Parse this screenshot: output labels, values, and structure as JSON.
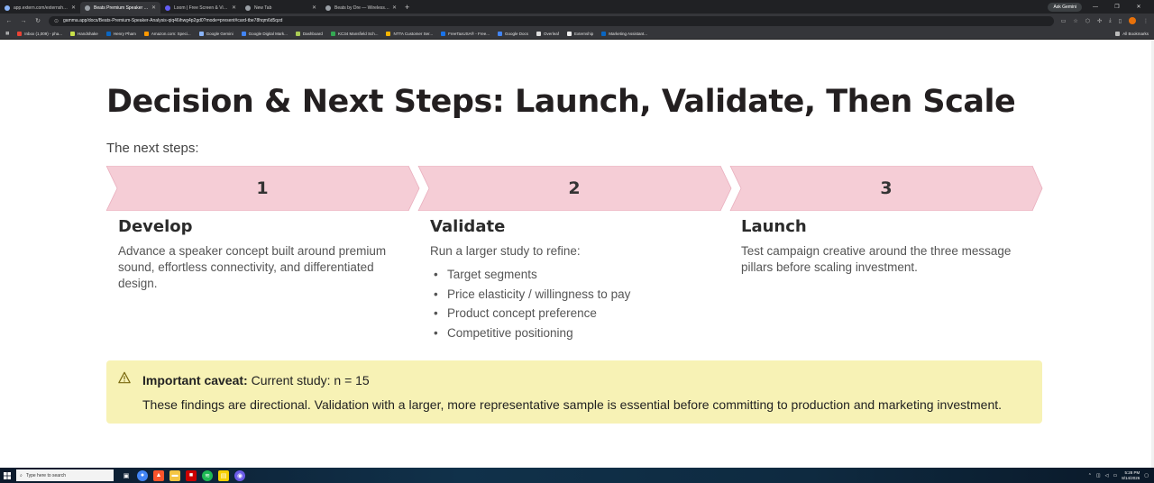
{
  "browser": {
    "tabs": [
      {
        "title": "app.extern.com/externships/6/...",
        "active": false
      },
      {
        "title": "Beats Premium Speaker Analy...",
        "active": true
      },
      {
        "title": "Loom | Free Screen & Video Re...",
        "active": false
      },
      {
        "title": "New Tab",
        "active": false
      },
      {
        "title": "Beats by Dre — Wireless Speak...",
        "active": false
      }
    ],
    "ask_gemini": "Ask Gemini",
    "url": "gamma.app/docs/Beats-Premium-Speaker-Analysis-qiq46ihwg4p2gd0?mode=present#card-tbe78hqm6d5qzd",
    "bookmarks": [
      "Inbox (1,009) - pha...",
      "Handshake",
      "Henry Pham",
      "Amazon.com: Speci...",
      "Google Gemini",
      "Google Digital Mark...",
      "Dashboard",
      "KC34 Mansfield Sch...",
      "NTTA Customer Ser...",
      "FreeTaxUSA® - Free...",
      "Google Docs",
      "Overleaf",
      "Externship",
      "Marketing Assistant..."
    ],
    "all_bookmarks": "All Bookmarks"
  },
  "slide": {
    "title": "Decision & Next Steps: Launch, Validate, Then Scale",
    "subtitle": "The next steps:",
    "chevron_color": "#f5cdd6",
    "steps": [
      {
        "number": "1",
        "heading": "Develop",
        "text": "Advance a speaker concept built around premium sound, effortless connectivity, and differentiated design."
      },
      {
        "number": "2",
        "heading": "Validate",
        "text": "Run a larger study to refine:",
        "bullets": [
          "Target segments",
          "Price elasticity / willingness to pay",
          "Product concept preference",
          "Competitive positioning"
        ]
      },
      {
        "number": "3",
        "heading": "Launch",
        "text": "Test campaign creative around the three message pillars before scaling investment."
      }
    ],
    "caveat": {
      "label": "Important caveat:",
      "detail": " Current study: n = 15",
      "body": "These findings are directional. Validation with a larger, more representative sample is essential before committing to production and marketing investment.",
      "bg_color": "#f7f2b5",
      "icon": "warning-icon"
    }
  },
  "taskbar": {
    "search_placeholder": "Type here to search",
    "time": "5:28 PM",
    "date": "8/14/2026"
  }
}
